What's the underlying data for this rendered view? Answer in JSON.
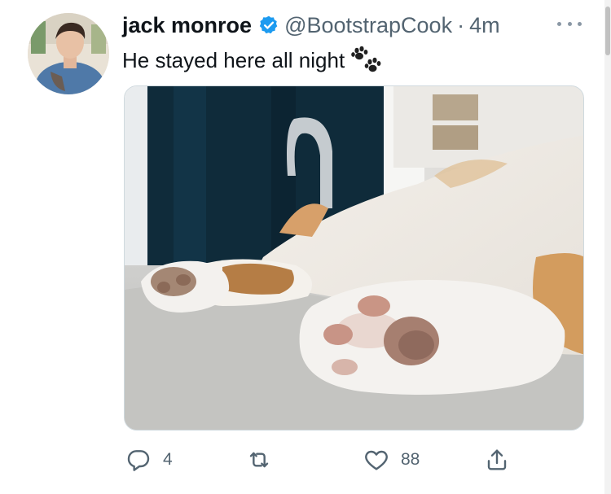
{
  "tweet": {
    "author_name": "jack monroe",
    "verified": true,
    "handle": "@BootstrapCook",
    "separator": "·",
    "time": "4m",
    "text": "He stayed here all night",
    "emoji_icon": "paw-prints-icon",
    "media": {
      "description_icon": "cat-paws-photo"
    }
  },
  "actions": {
    "reply_count": "4",
    "retweet_count": "",
    "like_count": "88"
  },
  "colors": {
    "verified_blue": "#1d9bf0",
    "secondary_text": "#536471",
    "primary_text": "#0f1419"
  }
}
